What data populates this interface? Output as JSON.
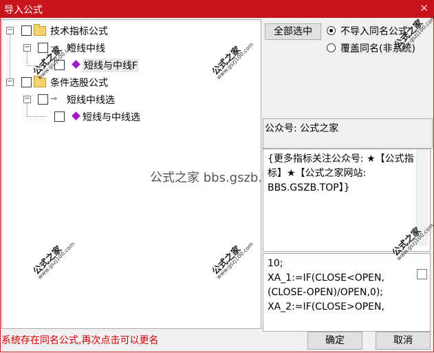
{
  "window": {
    "title": "导入公式",
    "close_glyph": "✕"
  },
  "tree": {
    "nodes": [
      {
        "label": "技术指标公式",
        "type": "folder"
      },
      {
        "label": "短线中线",
        "type": "key"
      },
      {
        "label": "短线与中线F",
        "type": "gem",
        "selected": true
      },
      {
        "label": "条件选股公式",
        "type": "folder"
      },
      {
        "label": "短线中线选",
        "type": "key"
      },
      {
        "label": "短线与中线选",
        "type": "gem"
      }
    ],
    "expand_glyph": "−"
  },
  "actions": {
    "select_all_label": "全部选中",
    "radio_skip_label": "不导入同名公式",
    "radio_overwrite_label": "覆盖同名(非系统)"
  },
  "info": {
    "account_label": "公众号: 公式之家",
    "description": "{更多指标关注公众号: ★【公式指标】★【公式之家网站: BBS.GSZB.TOP】}",
    "code_lines": [
      "10;",
      "XA_1:=IF(CLOSE<OPEN,",
      "(CLOSE-OPEN)/OPEN,0);",
      "XA_2:=IF(CLOSE>OPEN,"
    ]
  },
  "watermark": {
    "center_text": "公式之家 bbs.gszb.top",
    "stamp_text": "公式之家",
    "stamp_url": "www.gszj100.com"
  },
  "status": {
    "message": "系统存在同名公式,再次点击可以更名"
  },
  "footer": {
    "ok_label": "确定",
    "cancel_label": "取消"
  },
  "colors": {
    "titlebar": "#c8151d",
    "status_text": "#d10000",
    "gem": "#a01bc8"
  }
}
